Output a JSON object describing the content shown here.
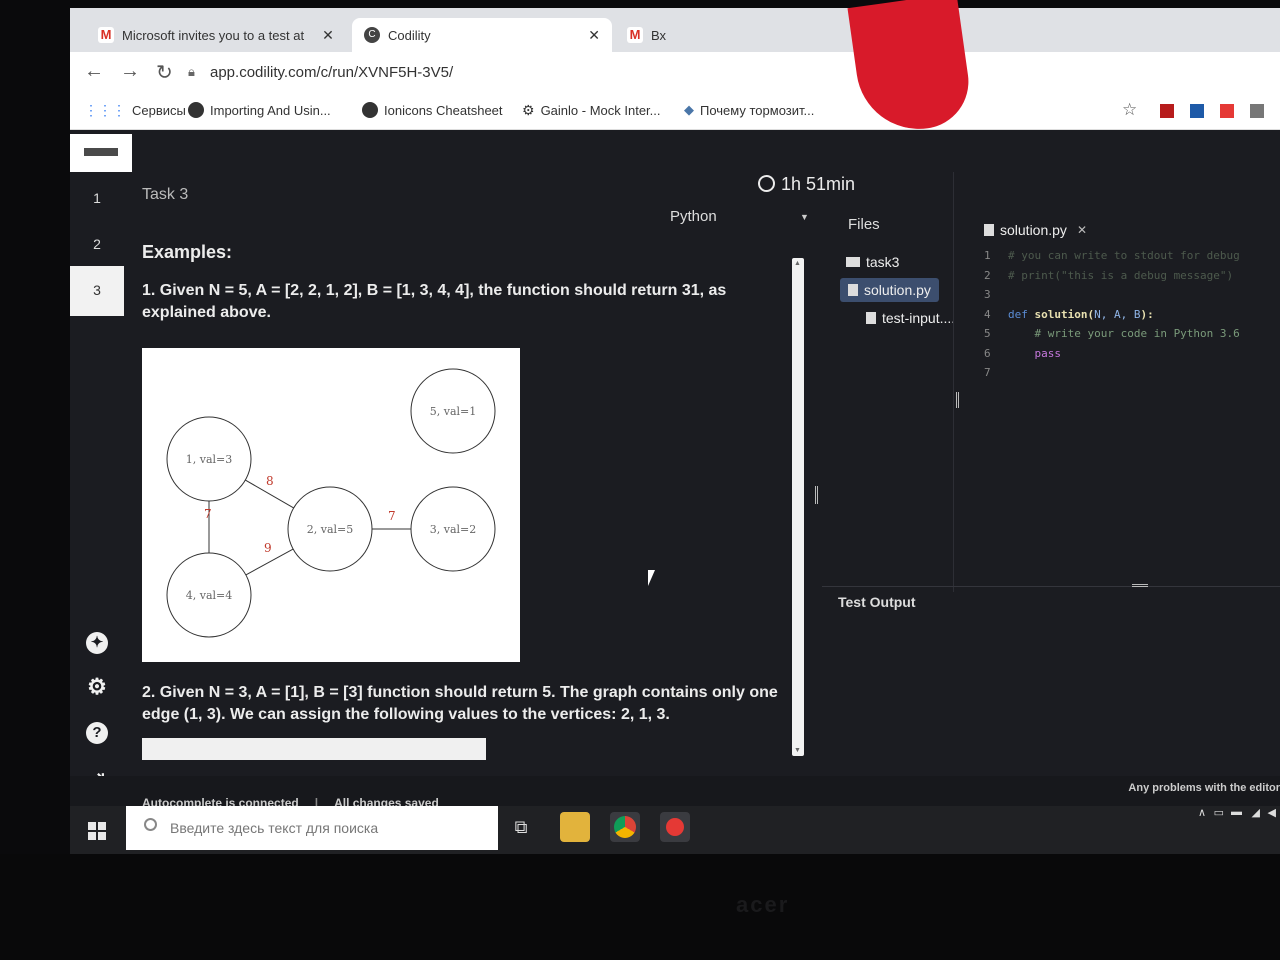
{
  "browser": {
    "tabs": [
      {
        "label": "Microsoft invites you to a test at",
        "icon": "gmail-icon"
      },
      {
        "label": "Codility",
        "icon": "codility-icon"
      },
      {
        "label": "Вх",
        "icon": "gmail-icon"
      }
    ],
    "url": "app.codility.com/c/run/XVNF5H-3V5/",
    "bookmarks": [
      {
        "label": "Сервисы",
        "icon": "apps-icon"
      },
      {
        "label": "Importing And Usin...",
        "icon": "site-icon"
      },
      {
        "label": "Ionicons Cheatsheet",
        "icon": "ionicons-icon"
      },
      {
        "label": "Gainlo - Mock Inter...",
        "icon": "gainlo-icon"
      },
      {
        "label": "Почему тормозит...",
        "icon": "vk-icon"
      }
    ]
  },
  "header": {
    "timer": "1h 51min"
  },
  "rail": {
    "items": [
      "1",
      "2",
      "3"
    ],
    "active": "3"
  },
  "task": {
    "title": "Task 3",
    "language": "Python",
    "examples_heading": "Examples:",
    "example1": "1. Given N = 5, A = [2, 2, 1, 2], B = [1, 3, 4, 4], the function should return 31, as explained above.",
    "example2": "2. Given N = 3, A = [1], B = [3] function should return 5. The graph contains only one edge (1, 3). We can assign the following values to the vertices: 2, 1, 3.",
    "graph": {
      "nodes": [
        {
          "id": "n5",
          "label": "5, val=1"
        },
        {
          "id": "n1",
          "label": "1, val=3"
        },
        {
          "id": "n2",
          "label": "2, val=5"
        },
        {
          "id": "n3",
          "label": "3, val=2"
        },
        {
          "id": "n4",
          "label": "4, val=4"
        }
      ],
      "edges": [
        {
          "from": "n1",
          "to": "n2",
          "weight": "8"
        },
        {
          "from": "n1",
          "to": "n4",
          "weight": "7"
        },
        {
          "from": "n2",
          "to": "n3",
          "weight": "7"
        },
        {
          "from": "n2",
          "to": "n4",
          "weight": "9"
        }
      ],
      "edge_label_color": "#c0392b"
    }
  },
  "files": {
    "heading": "Files",
    "folder": "task3",
    "items": [
      "solution.py",
      "test-input...."
    ]
  },
  "editor": {
    "tab": "solution.py",
    "lines": [
      {
        "n": "1",
        "text": "# you can write to stdout for debug"
      },
      {
        "n": "2",
        "text": "# print(\"this is a debug message\")"
      },
      {
        "n": "3",
        "text": ""
      },
      {
        "n": "4",
        "kw": "def",
        "fn": "solution(",
        "params": "N, A, B",
        "end": "):"
      },
      {
        "n": "5",
        "text": "    # write your code in Python 3.6"
      },
      {
        "n": "6",
        "text": "    pass"
      },
      {
        "n": "7",
        "text": ""
      }
    ]
  },
  "output": {
    "label": "Test Output"
  },
  "footer": {
    "autocomplete": "Autocomplete is connected",
    "saved": "All changes saved",
    "problems": "Any problems with the editor"
  },
  "taskbar": {
    "search_placeholder": "Введите здесь текст для поиска"
  },
  "colors": {
    "accent_active_file": "#3c4e6e",
    "keyword": "#5b8dd6",
    "pass": "#c678dd"
  }
}
